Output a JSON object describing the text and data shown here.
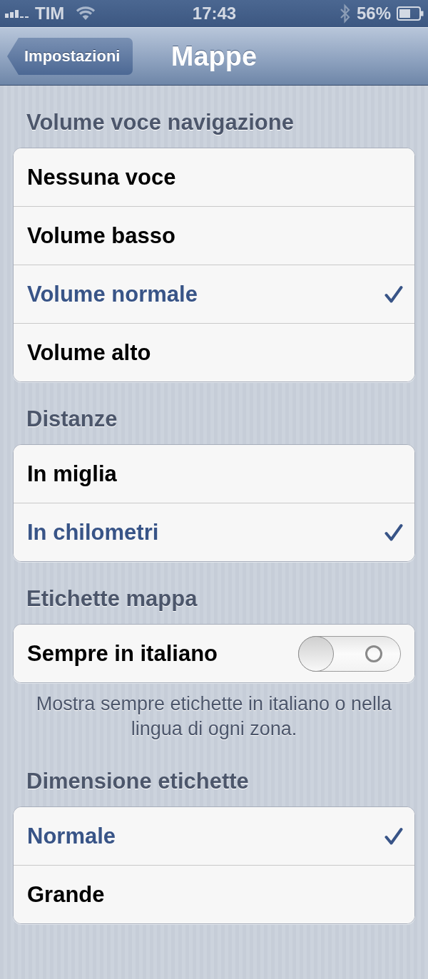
{
  "status_bar": {
    "carrier": "TIM",
    "time": "17:43",
    "battery_percent": "56%"
  },
  "nav_bar": {
    "back_button": "Impostazioni",
    "title": "Mappe"
  },
  "sections": [
    {
      "header": "Volume voce navigazione",
      "rows": [
        {
          "kind": "choice",
          "label": "Nessuna voce",
          "selected": false
        },
        {
          "kind": "choice",
          "label": "Volume basso",
          "selected": false
        },
        {
          "kind": "choice",
          "label": "Volume normale",
          "selected": true
        },
        {
          "kind": "choice",
          "label": "Volume alto",
          "selected": false
        }
      ]
    },
    {
      "header": "Distanze",
      "rows": [
        {
          "kind": "choice",
          "label": "In miglia",
          "selected": false
        },
        {
          "kind": "choice",
          "label": "In chilometri",
          "selected": true
        }
      ]
    },
    {
      "header": "Etichette mappa",
      "rows": [
        {
          "kind": "switch",
          "label": "Sempre in italiano",
          "on": false
        }
      ],
      "footer": "Mostra sempre etichette in italiano o nella lingua di ogni zona."
    },
    {
      "header": "Dimensione etichette",
      "rows": [
        {
          "kind": "choice",
          "label": "Normale",
          "selected": true
        },
        {
          "kind": "choice",
          "label": "Grande",
          "selected": false
        }
      ]
    }
  ]
}
